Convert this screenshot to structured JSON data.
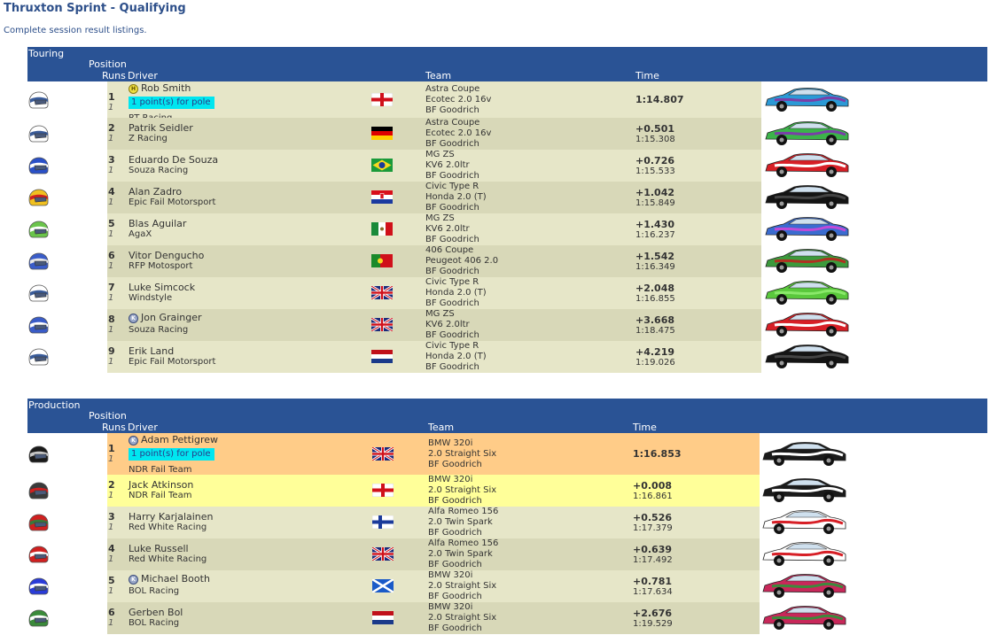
{
  "page": {
    "title": "Thruxton Sprint - Qualifying",
    "subtitle": "Complete session result listings."
  },
  "headers": {
    "position": "Position",
    "runs": "Runs",
    "driver": "Driver",
    "team": "Team",
    "time": "Time"
  },
  "classes": [
    {
      "name": "Touring",
      "rows": [
        {
          "pos": "1",
          "runs": "1",
          "driver": "Rob Smith",
          "badge": "H",
          "pole": "1 point(s) for pole",
          "team_name": "RT Racing",
          "car": [
            "Astra Coupe",
            "Ecotec 2.0 16v",
            "BF Goodrich"
          ],
          "gap": "",
          "lap": "1:14.807",
          "flag": "england",
          "helmet": [
            "#ffffff",
            "#3a5c9a"
          ],
          "skin": [
            "#2b9ad6",
            "#7a3fa8"
          ],
          "bg": "#e6e6c8"
        },
        {
          "pos": "2",
          "runs": "1",
          "driver": "Patrik Seidler",
          "team_name": "Z Racing",
          "car": [
            "Astra Coupe",
            "Ecotec 2.0 16v",
            "BF Goodrich"
          ],
          "gap": "+0.501",
          "lap": "1:15.308",
          "flag": "germany",
          "helmet": [
            "#ffffff",
            "#3a5c9a"
          ],
          "skin": [
            "#3cb34a",
            "#7a3fa8"
          ],
          "bg": "#d8d8b8"
        },
        {
          "pos": "3",
          "runs": "1",
          "driver": "Eduardo De Souza",
          "team_name": "Souza Racing",
          "car": [
            "MG ZS",
            "KV6 2.0ltr",
            "BF Goodrich"
          ],
          "gap": "+0.726",
          "lap": "1:15.533",
          "flag": "brazil",
          "helmet": [
            "#2a50c8",
            "#ffffff"
          ],
          "skin": [
            "#d71f26",
            "#ffffff"
          ],
          "bg": "#e6e6c8"
        },
        {
          "pos": "4",
          "runs": "1",
          "driver": "Alan Zadro",
          "team_name": "Epic Fail Motorsport",
          "car": [
            "Civic Type R",
            "Honda 2.0 (T)",
            "BF Goodrich"
          ],
          "gap": "+1.042",
          "lap": "1:15.849",
          "flag": "croatia",
          "helmet": [
            "#f0c020",
            "#d02020"
          ],
          "skin": [
            "#141414",
            "#444444"
          ],
          "bg": "#d8d8b8"
        },
        {
          "pos": "5",
          "runs": "1",
          "driver": "Blas Aguilar",
          "team_name": "AgaX",
          "car": [
            "MG ZS",
            "KV6 2.0ltr",
            "BF Goodrich"
          ],
          "gap": "+1.430",
          "lap": "1:16.237",
          "flag": "mexico",
          "helmet": [
            "#6ac44a",
            "#ffffff"
          ],
          "skin": [
            "#3a6cd0",
            "#c04ad8"
          ],
          "bg": "#e6e6c8"
        },
        {
          "pos": "6",
          "runs": "1",
          "driver": "Vitor Dengucho",
          "team_name": "RFP Motosport",
          "car": [
            "406 Coupe",
            "Peugeot 406 2.0",
            "BF Goodrich"
          ],
          "gap": "+1.542",
          "lap": "1:16.349",
          "flag": "portugal",
          "helmet": [
            "#3a5cc8",
            "#e8e8e8"
          ],
          "skin": [
            "#3c9a3c",
            "#b03020"
          ],
          "bg": "#d8d8b8"
        },
        {
          "pos": "7",
          "runs": "1",
          "driver": "Luke Simcock",
          "team_name": "Windstyle",
          "car": [
            "Civic Type R",
            "Honda 2.0 (T)",
            "BF Goodrich"
          ],
          "gap": "+2.048",
          "lap": "1:16.855",
          "flag": "uk",
          "helmet": [
            "#ffffff",
            "#3a5c9a"
          ],
          "skin": [
            "#5ac83c",
            "#8ae86a"
          ],
          "bg": "#e6e6c8"
        },
        {
          "pos": "8",
          "runs": "1",
          "driver": "Jon Grainger",
          "badge": "K",
          "team_name": "Souza Racing",
          "car": [
            "MG ZS",
            "KV6 2.0ltr",
            "BF Goodrich"
          ],
          "gap": "+3.668",
          "lap": "1:18.475",
          "flag": "uk",
          "helmet": [
            "#3a5cc8",
            "#ffffff"
          ],
          "skin": [
            "#d71f26",
            "#ffffff"
          ],
          "bg": "#d8d8b8"
        },
        {
          "pos": "9",
          "runs": "1",
          "driver": "Erik Land",
          "team_name": "Epic Fail Motorsport",
          "car": [
            "Civic Type R",
            "Honda 2.0 (T)",
            "BF Goodrich"
          ],
          "gap": "+4.219",
          "lap": "1:19.026",
          "flag": "netherlands",
          "helmet": [
            "#ffffff",
            "#3a5c9a"
          ],
          "skin": [
            "#141414",
            "#444444"
          ],
          "bg": "#e6e6c8"
        }
      ]
    },
    {
      "name": "Production",
      "rows": [
        {
          "pos": "1",
          "runs": "1",
          "driver": "Adam Pettigrew",
          "badge": "K",
          "pole": "1 point(s) for pole",
          "team_name": "NDR Fail Team",
          "car": [
            "BMW 320i",
            "2.0 Straight Six",
            "BF Goodrich"
          ],
          "gap": "",
          "lap": "1:16.853",
          "flag": "uk",
          "helmet": [
            "#1a1a1a",
            "#c8c8c8"
          ],
          "skin": [
            "#1a1a1a",
            "#ffffff"
          ],
          "bg": "#ffcc88"
        },
        {
          "pos": "2",
          "runs": "1",
          "driver": "Jack Atkinson",
          "team_name": "NDR Fail Team",
          "car": [
            "BMW 320i",
            "2.0 Straight Six",
            "BF Goodrich"
          ],
          "gap": "+0.008",
          "lap": "1:16.861",
          "flag": "england",
          "helmet": [
            "#3a3a3a",
            "#d02020"
          ],
          "skin": [
            "#1a1a1a",
            "#ffffff"
          ],
          "bg": "#ffff99"
        },
        {
          "pos": "3",
          "runs": "1",
          "driver": "Harry Karjalainen",
          "team_name": "Red White Racing",
          "car": [
            "Alfa Romeo 156",
            "2.0 Twin Spark",
            "BF Goodrich"
          ],
          "gap": "+0.526",
          "lap": "1:17.379",
          "flag": "finland",
          "helmet": [
            "#d02020",
            "#3a7a3a"
          ],
          "skin": [
            "#ffffff",
            "#d71f26"
          ],
          "bg": "#e6e6c8"
        },
        {
          "pos": "4",
          "runs": "1",
          "driver": "Luke Russell",
          "team_name": "Red White Racing",
          "car": [
            "Alfa Romeo 156",
            "2.0 Twin Spark",
            "BF Goodrich"
          ],
          "gap": "+0.639",
          "lap": "1:17.492",
          "flag": "uk",
          "helmet": [
            "#d02020",
            "#ffffff"
          ],
          "skin": [
            "#ffffff",
            "#d71f26"
          ],
          "bg": "#d8d8b8"
        },
        {
          "pos": "5",
          "runs": "1",
          "driver": "Michael Booth",
          "badge": "K",
          "team_name": "BOL Racing",
          "car": [
            "BMW 320i",
            "2.0 Straight Six",
            "BF Goodrich"
          ],
          "gap": "+0.781",
          "lap": "1:17.634",
          "flag": "scotland",
          "helmet": [
            "#2a3cd8",
            "#ffffff"
          ],
          "skin": [
            "#c8285a",
            "#3c8a3c"
          ],
          "bg": "#e6e6c8"
        },
        {
          "pos": "6",
          "runs": "1",
          "driver": "Gerben Bol",
          "team_name": "BOL Racing",
          "car": [
            "BMW 320i",
            "2.0 Straight Six",
            "BF Goodrich"
          ],
          "gap": "+2.676",
          "lap": "1:19.529",
          "flag": "netherlands",
          "helmet": [
            "#3a8a3a",
            "#ffffff"
          ],
          "skin": [
            "#c8285a",
            "#3c8a3c"
          ],
          "bg": "#d8d8b8"
        }
      ]
    }
  ]
}
